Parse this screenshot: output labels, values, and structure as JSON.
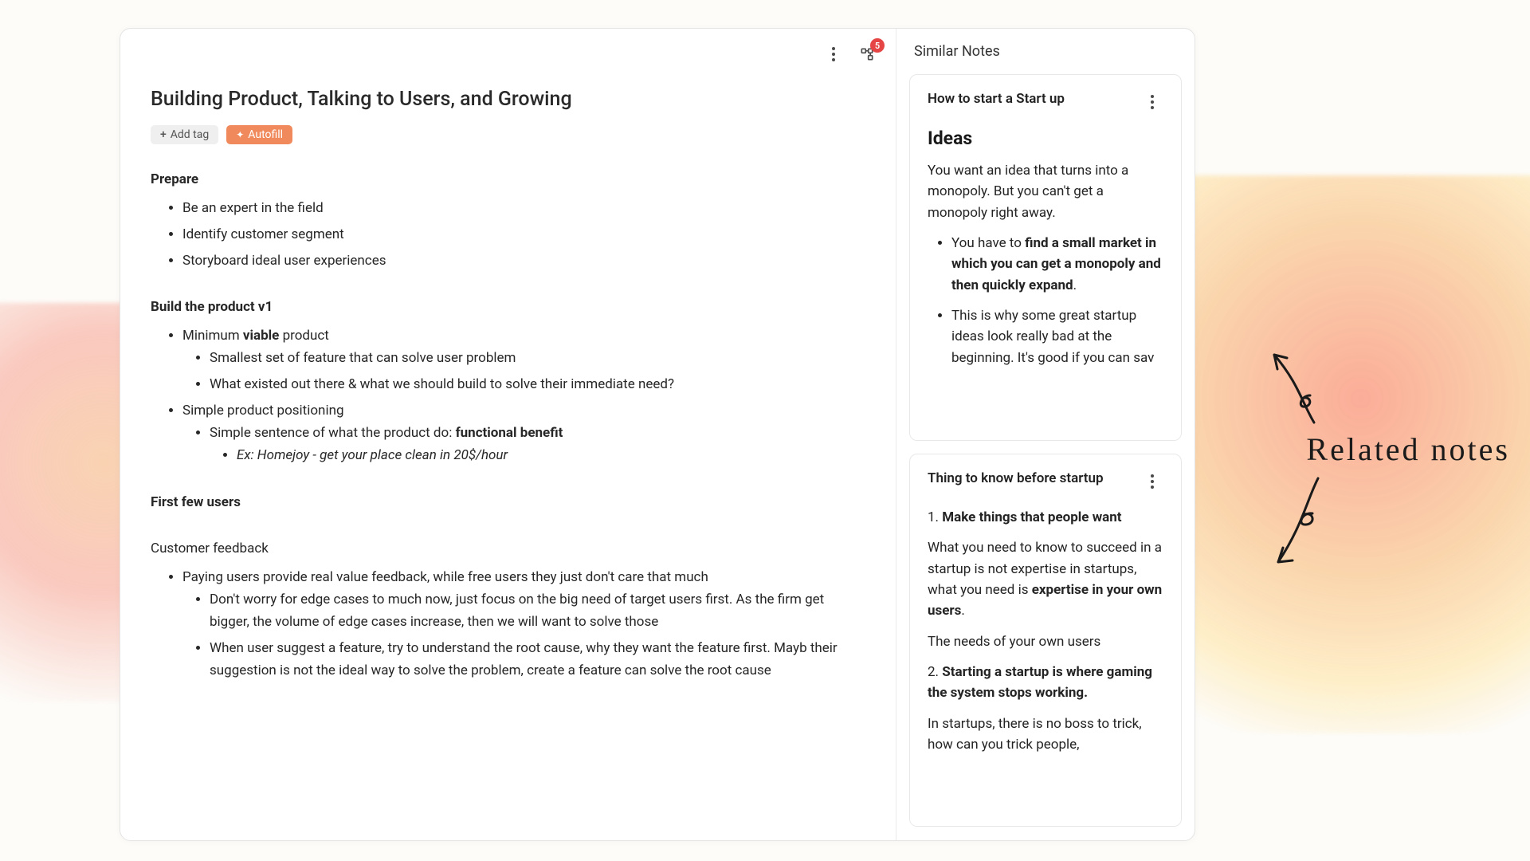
{
  "toolbar": {
    "badge_count": "5"
  },
  "page": {
    "title": "Building Product, Talking to Users, and Growing",
    "add_tag_label": "Add tag",
    "autofill_label": "Autofill"
  },
  "note": {
    "h_prepare": "Prepare",
    "prepare_items": {
      "0": "Be an expert in the field",
      "1": "Identify customer segment",
      "2": "Storyboard ideal user experiences"
    },
    "h_build": "Build the product v1",
    "mvp_prefix": "Minimum ",
    "mvp_bold": "viable",
    "mvp_suffix": " product",
    "mvp_sub": {
      "0": "Smallest set of feature that can solve user problem",
      "1": "What existed out there & what we should build to solve their immediate need?"
    },
    "positioning": "Simple product positioning",
    "pos_sub_prefix": "Simple sentence of what the product do: ",
    "pos_sub_bold": "functional benefit",
    "pos_example": "Ex: Homejoy - get your place clean in 20$/hour",
    "h_first_users": "First few users",
    "h_feedback": "Customer feedback",
    "feedback_main": "Paying users provide real value feedback, while free users they just don't care that much",
    "feedback_sub": {
      "0": "Don't worry for edge cases to much now, just focus on the big need of target users first. As the firm get bigger, the volume of edge cases increase, then we will want to solve those",
      "1": "When user suggest a feature, try to understand the root cause, why they want the feature first. Mayb their suggestion is not the ideal way to solve the problem, create a feature can solve the root cause"
    }
  },
  "side": {
    "header": "Similar Notes",
    "card1": {
      "title": "How to start a Start up",
      "h": "Ideas",
      "p1": "You want an idea that turns into a monopoly. But you can't get a monopoly right away.",
      "li1_prefix": "You have to ",
      "li1_bold": "find a small market in which you can get a monopoly and then quickly expand",
      "li1_suffix": ".",
      "li2": "This is why some great startup ideas look really bad at the beginning. It's good if you can sav"
    },
    "card2": {
      "title": "Thing to know before startup",
      "n1_num": "1. ",
      "n1_bold": "Make things that people want",
      "n1_p1_prefix": "What you need to know to succeed in a startup is not expertise in startups, what you need is ",
      "n1_p1_bold": "expertise in your own users",
      "n1_p1_suffix": ".",
      "n1_p2": "The needs of your own users",
      "n2_num": "2. ",
      "n2_bold": "Starting a startup is where gaming the system stops working.",
      "n2_p": "In startups, there is no boss to trick, how can you trick people,"
    }
  },
  "annotation": {
    "text": "Related notes"
  }
}
